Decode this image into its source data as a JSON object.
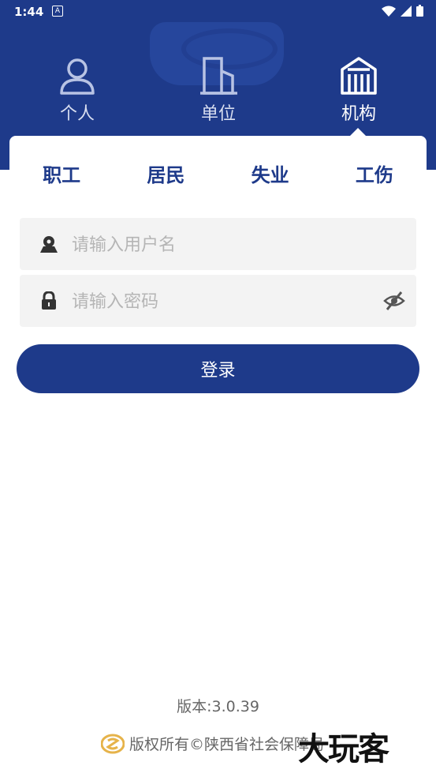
{
  "status_bar": {
    "time": "1:44",
    "notif": "A"
  },
  "role_tabs": [
    {
      "label": "个人",
      "icon": "person-icon",
      "active": false
    },
    {
      "label": "单位",
      "icon": "building-icon",
      "active": false
    },
    {
      "label": "机构",
      "icon": "institution-icon",
      "active": true
    }
  ],
  "sub_tabs": [
    "职工",
    "居民",
    "失业",
    "工伤"
  ],
  "form": {
    "username_placeholder": "请输入用户名",
    "password_placeholder": "请输入密码",
    "login_label": "登录"
  },
  "footer": {
    "version": "版本:3.0.39",
    "copyright": "版权所有©陕西省社会保障局"
  },
  "watermark": "大玩客",
  "colors": {
    "primary": "#1e3a8a",
    "field_bg": "#f3f3f3"
  }
}
